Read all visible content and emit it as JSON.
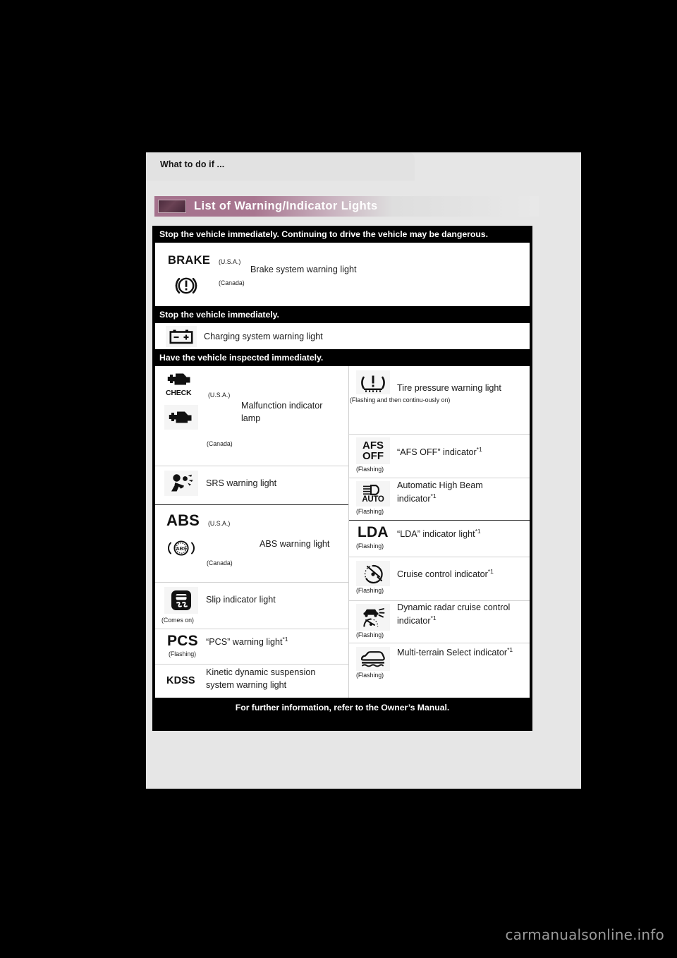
{
  "tab": {
    "label": "What to do if ..."
  },
  "section": {
    "title": "List of Warning/Indicator Lights"
  },
  "bands": {
    "danger": "Stop the vehicle immediately. Continuing to drive the vehicle may be dangerous.",
    "stop": "Stop the vehicle immediately.",
    "inspect": "Have the vehicle inspected immediately.",
    "footer": "For further information, refer to the Owner’s Manual."
  },
  "brake": {
    "usa_icon_text": "BRAKE",
    "usa_tag": "(U.S.A.)",
    "canada_tag": "(Canada)",
    "description": "Brake system warning light"
  },
  "charging": {
    "description": "Charging system warning light"
  },
  "left_column": [
    {
      "icon": "check-engine-icon",
      "icon_text": "CHECK",
      "usa_tag": "(U.S.A.)",
      "canada_tag": "(Canada)",
      "description": "Malfunction indicator lamp"
    },
    {
      "icon": "srs-airbag-icon",
      "description": "SRS warning light",
      "note": ""
    },
    {
      "icon": "abs-icon",
      "icon_text": "ABS",
      "usa_tag": "(U.S.A.)",
      "canada_tag": "(Canada)",
      "description": "ABS warning light"
    },
    {
      "icon": "slip-indicator-icon",
      "description": "Slip indicator light",
      "note": "(Comes on)"
    },
    {
      "icon": "pcs-icon",
      "icon_text": "PCS",
      "description": "“PCS” warning light",
      "footnote": "*1",
      "note": "(Flashing)"
    },
    {
      "icon": "kdss-icon",
      "icon_text": "KDSS",
      "description": "Kinetic dynamic suspension system warning light"
    }
  ],
  "right_column": [
    {
      "icon": "tire-pressure-icon",
      "description": "Tire pressure warning light",
      "note": "(Flashing and then continu-ously on)"
    },
    {
      "icon": "afs-off-icon",
      "icon_text": "AFS OFF",
      "description": "“AFS OFF” indicator",
      "footnote": "*1",
      "note": "(Flashing)"
    },
    {
      "icon": "auto-high-beam-icon",
      "icon_text": "AUTO",
      "description": "Automatic High Beam indicator",
      "footnote": "*1",
      "note": "(Flashing)"
    },
    {
      "icon": "lda-icon",
      "icon_text": "LDA",
      "description": "“LDA” indicator light",
      "footnote": "*1",
      "note": "(Flashing)"
    },
    {
      "icon": "cruise-control-icon",
      "description": "Cruise control indicator",
      "footnote": "*1",
      "note": "(Flashing)"
    },
    {
      "icon": "dynamic-radar-cruise-icon",
      "description": "Dynamic radar cruise control indicator",
      "footnote": "*1",
      "note": "(Flashing)"
    },
    {
      "icon": "multi-terrain-select-icon",
      "description": "Multi-terrain Select indicator",
      "footnote": "*1",
      "note": "(Flashing)"
    }
  ],
  "watermark": {
    "text": "carmanualsonline.info"
  },
  "colors": {
    "page_bg": "#e6e6e6",
    "band_bg": "#000000",
    "accent": "#a4718c",
    "icon_box": "#f5f5f5"
  }
}
